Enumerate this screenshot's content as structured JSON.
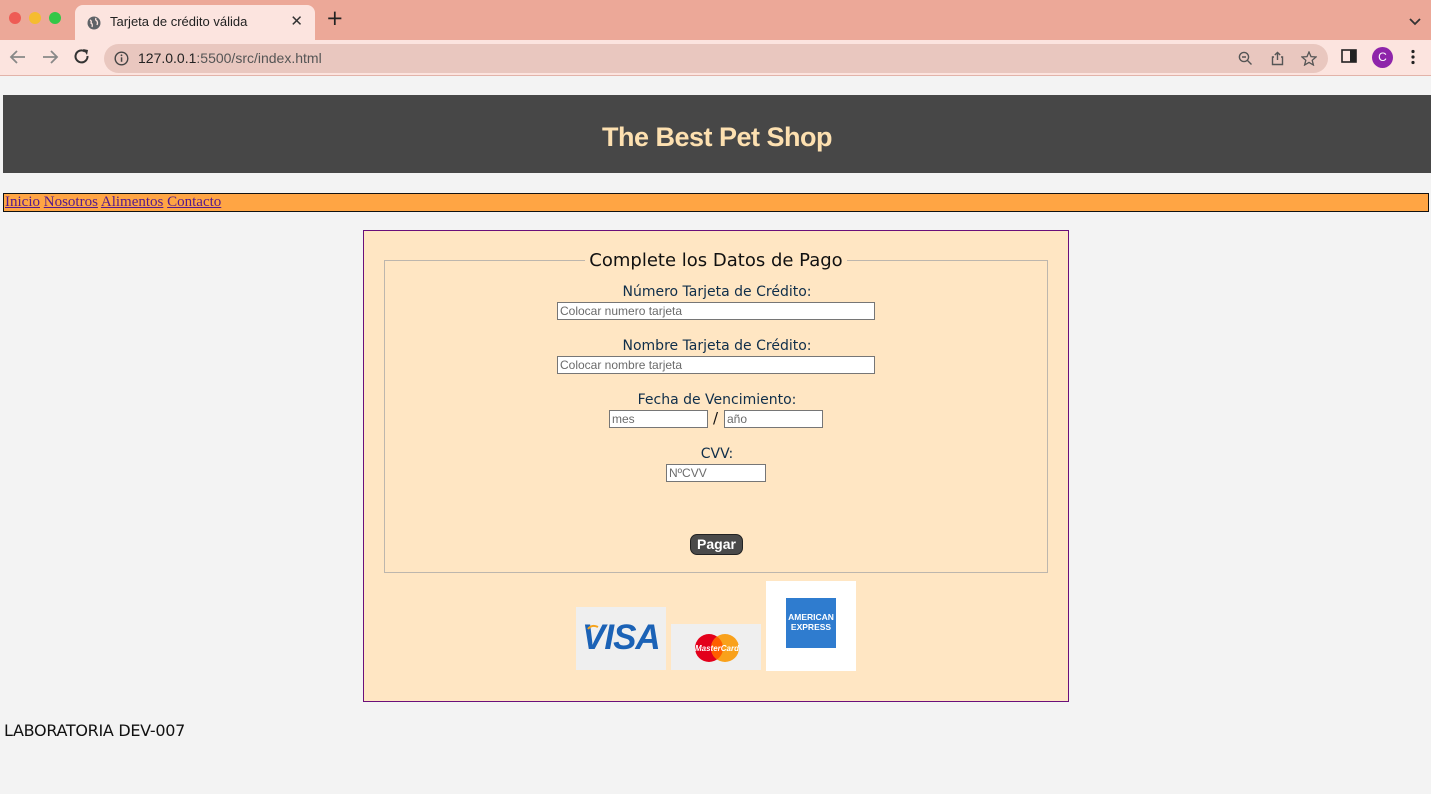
{
  "browser": {
    "tab_title": "Tarjeta de crédito válida",
    "new_tab_label": "+",
    "url_host": "127.0.0.1",
    "url_path": ":5500/src/index.html",
    "profile_initial": "C"
  },
  "site": {
    "title": "The Best Pet Shop",
    "nav": [
      "Inicio",
      "Nosotros",
      "Alimentos",
      "Contacto"
    ]
  },
  "form": {
    "legend": "Complete los Datos de Pago",
    "card_number_label": "Número Tarjeta de Crédito:",
    "card_number_placeholder": "Colocar numero tarjeta",
    "card_name_label": "Nombre Tarjeta de Crédito:",
    "card_name_placeholder": "Colocar nombre tarjeta",
    "expiry_label": "Fecha de Vencimiento:",
    "month_placeholder": "mes",
    "separator": "/",
    "year_placeholder": "año",
    "cvv_label": "CVV:",
    "cvv_placeholder": "NºCVV",
    "submit_label": "Pagar"
  },
  "cards": {
    "visa": "VISA",
    "mastercard": "MasterCard",
    "amex_line1": "AMERICAN",
    "amex_line2": "EXPRESS"
  },
  "footer": {
    "text": "LABORATORIA DEV-007"
  },
  "colors": {
    "header_bg": "#474747",
    "header_text": "#fde0b0",
    "nav_bg": "#ffa544",
    "form_bg": "#ffe6c3",
    "button_bg": "#4a4a4a"
  },
  "icons": [
    "globe-icon",
    "close-icon",
    "back-icon",
    "forward-icon",
    "reload-icon",
    "info-icon",
    "zoom-icon",
    "share-icon",
    "star-icon",
    "sidebar-icon",
    "menu-icon",
    "chevron-down-icon"
  ]
}
